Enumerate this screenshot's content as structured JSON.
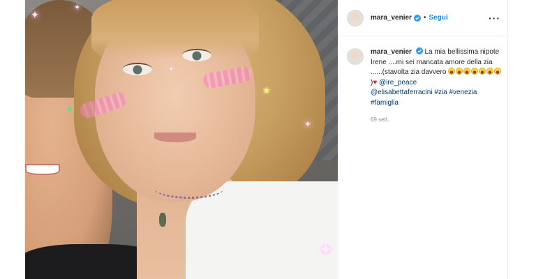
{
  "post": {
    "photo_alt": "Selfie photo",
    "header": {
      "username": "mara_venier",
      "separator": "•",
      "follow_label": "Segui",
      "more_label": "···"
    },
    "caption": {
      "username": "mara_venier",
      "text_line1": "La mia bellissima nipote Irene ....mi sei mancata amore della zia ......(stavolta zia davvero",
      "laugh_emoji_count": 7,
      "closing": ")",
      "mention1": "@ire_peace",
      "mention2": "@elisabettaferracini",
      "hashtag1": "#zia",
      "hashtag2": "#venezia",
      "hashtag3": "#famiglia",
      "timestamp": "69 sett."
    },
    "colors": {
      "follow": "#0095f6",
      "link": "#00376b",
      "verified": "#3897f0",
      "timestamp": "#8e8e8e"
    }
  }
}
